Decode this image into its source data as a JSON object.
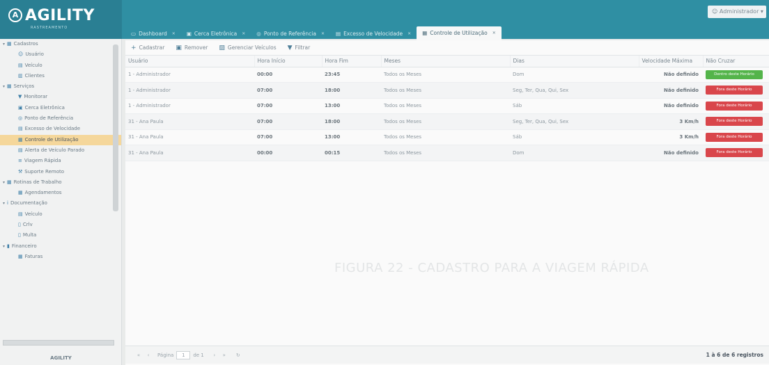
{
  "brand": {
    "name": "AGILITY",
    "subtitle": "RASTREAMENTO"
  },
  "user": {
    "label": "Administrador"
  },
  "tabs": [
    {
      "label": "Dashboard",
      "icon": "monitor-icon"
    },
    {
      "label": "Cerca Eletrônica",
      "icon": "lock-icon"
    },
    {
      "label": "Ponto de Referência",
      "icon": "globe-icon"
    },
    {
      "label": "Excesso de Velocidade",
      "icon": "car-icon"
    },
    {
      "label": "Controle de Utilização",
      "icon": "calendar-icon",
      "active": true
    }
  ],
  "sidebar": {
    "items": [
      {
        "label": "Cadastros",
        "level": 0,
        "icon": "grid-icon"
      },
      {
        "label": "Usuário",
        "level": 1,
        "icon": "user-icon"
      },
      {
        "label": "Veículo",
        "level": 1,
        "icon": "car-icon"
      },
      {
        "label": "Clientes",
        "level": 1,
        "icon": "building-icon"
      },
      {
        "label": "Serviços",
        "level": 0,
        "icon": "grid-icon"
      },
      {
        "label": "Monitorar",
        "level": 1,
        "icon": "pin-icon"
      },
      {
        "label": "Cerca Eletrônica",
        "level": 1,
        "icon": "lock-icon"
      },
      {
        "label": "Ponto de Referência",
        "level": 1,
        "icon": "globe-icon"
      },
      {
        "label": "Excesso de Velocidade",
        "level": 1,
        "icon": "car-icon"
      },
      {
        "label": "Controle de Utilização",
        "level": 1,
        "icon": "calendar-icon",
        "active": true
      },
      {
        "label": "Alerta de Veículo Parado",
        "level": 1,
        "icon": "car-icon"
      },
      {
        "label": "Viagem Rápida",
        "level": 1,
        "icon": "list-icon"
      },
      {
        "label": "Suporte Remoto",
        "level": 1,
        "icon": "wrench-icon"
      },
      {
        "label": "Rotinas de Trabalho",
        "level": 0,
        "icon": "grid-icon"
      },
      {
        "label": "Agendamentos",
        "level": 1,
        "icon": "calendar-icon"
      },
      {
        "label": "Documentação",
        "level": 0,
        "icon": "info-icon"
      },
      {
        "label": "Veículo",
        "level": 1,
        "icon": "car-icon"
      },
      {
        "label": "Crlv",
        "level": 1,
        "icon": "doc-icon"
      },
      {
        "label": "Multa",
        "level": 1,
        "icon": "doc-icon"
      },
      {
        "label": "Financeiro",
        "level": 0,
        "icon": "chart-icon"
      },
      {
        "label": "Faturas",
        "level": 1,
        "icon": "grid-icon"
      }
    ],
    "footer": "AGILITY"
  },
  "toolbar": {
    "add_label": "Cadastrar",
    "remove_label": "Remover",
    "manage_label": "Gerenciar Veículos",
    "filter_label": "Filtrar"
  },
  "table": {
    "columns": [
      "Usuário",
      "Hora Início",
      "Hora Fim",
      "Meses",
      "Dias",
      "Velocidade Máxima",
      "Não Cruzar"
    ],
    "rows": [
      {
        "usuario": "1 - Administrador",
        "inicio": "00:00",
        "fim": "23:45",
        "meses": "Todos os Meses",
        "dias": "Dom",
        "velocidade": "Não definido",
        "cruzar": "Dentro deste Horário",
        "cruzar_color": "green"
      },
      {
        "usuario": "1 - Administrador",
        "inicio": "07:00",
        "fim": "18:00",
        "meses": "Todos os Meses",
        "dias": "Seg, Ter, Qua, Qui, Sex",
        "velocidade": "Não definido",
        "cruzar": "Fora deste Horário",
        "cruzar_color": "red"
      },
      {
        "usuario": "1 - Administrador",
        "inicio": "07:00",
        "fim": "13:00",
        "meses": "Todos os Meses",
        "dias": "Sáb",
        "velocidade": "Não definido",
        "cruzar": "Fora deste Horário",
        "cruzar_color": "red"
      },
      {
        "usuario": "31 - Ana Paula",
        "inicio": "07:00",
        "fim": "18:00",
        "meses": "Todos os Meses",
        "dias": "Seg, Ter, Qua, Qui, Sex",
        "velocidade": "3 Km/h",
        "cruzar": "Fora deste Horário",
        "cruzar_color": "red"
      },
      {
        "usuario": "31 - Ana Paula",
        "inicio": "07:00",
        "fim": "13:00",
        "meses": "Todos os Meses",
        "dias": "Sáb",
        "velocidade": "3 Km/h",
        "cruzar": "Fora deste Horário",
        "cruzar_color": "red"
      },
      {
        "usuario": "31 - Ana Paula",
        "inicio": "00:00",
        "fim": "00:15",
        "meses": "Todos os Meses",
        "dias": "Dom",
        "velocidade": "Não definido",
        "cruzar": "Fora deste Horário",
        "cruzar_color": "red"
      }
    ]
  },
  "ghost_text": "FIGURA 22 - CADASTRO PARA A VIAGEM RÁPIDA",
  "pager": {
    "page_label": "Página",
    "page_value": "1",
    "of_label": "de 1",
    "info": "1 à 6 de 6 registros"
  },
  "colors": {
    "topbar": "#2f8fa3",
    "active_sidebar": "#f5d79b",
    "pill_green": "#54b44a",
    "pill_red": "#d9464b"
  }
}
